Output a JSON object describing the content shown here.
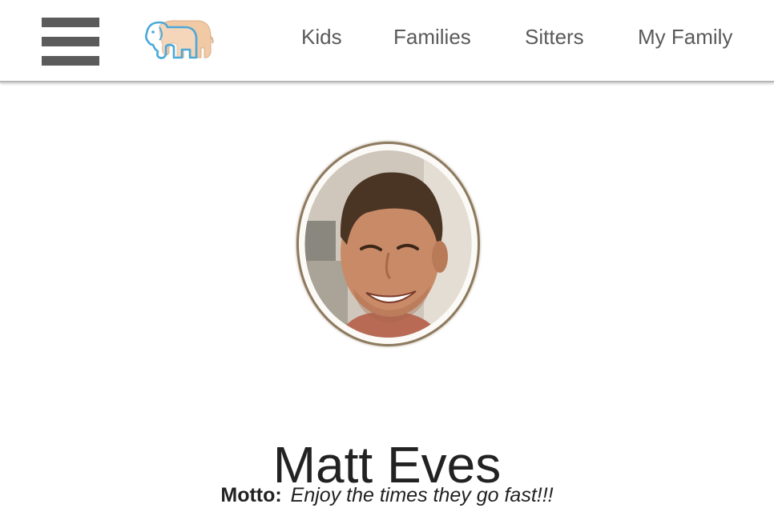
{
  "header": {
    "menu_icon": "hamburger-menu-icon",
    "logo_icon": "elephant-logo",
    "nav": [
      {
        "label": "Kids"
      },
      {
        "label": "Families"
      },
      {
        "label": "Sitters"
      },
      {
        "label": "My Family"
      }
    ]
  },
  "profile": {
    "avatar_icon": "profile-photo",
    "name": "Matt Eves",
    "motto_label": "Motto:",
    "motto": "Enjoy the times they go fast!!!"
  },
  "colors": {
    "nav_text": "#5a5a5a",
    "menu_icon": "#5b5b5b",
    "logo_blue": "#4aa9d8",
    "logo_peach": "#f2c9a5",
    "avatar_border": "#8d7a5e"
  }
}
